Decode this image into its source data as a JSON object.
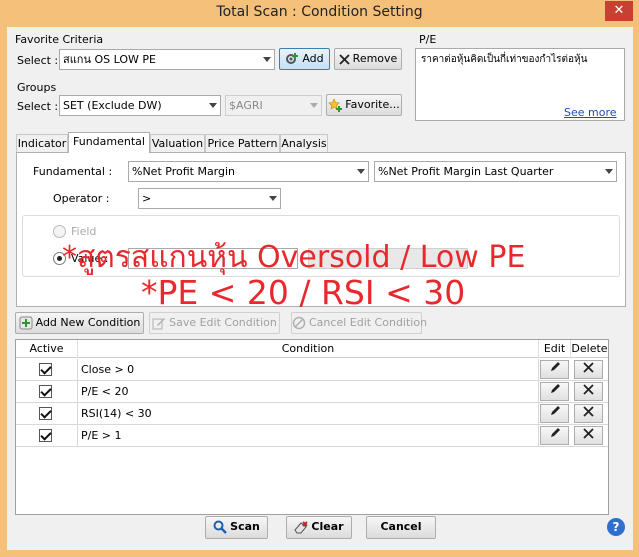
{
  "window": {
    "title": "Total Scan : Condition Setting",
    "close": "✕"
  },
  "favorite": {
    "group_label": "Favorite Criteria",
    "select_label": "Select :",
    "selected": "สแกน OS LOW PE",
    "add_label": "Add",
    "remove_label": "Remove"
  },
  "groups": {
    "group_label": "Groups",
    "select_label": "Select :",
    "selected": "SET (Exclude DW)",
    "sector": "$AGRI",
    "favorite_label": "Favorite..."
  },
  "pe_panel": {
    "title": "P/E",
    "description": "ราคาต่อหุ้นคิดเป็นกี่เท่าของกำไรต่อหุ้น",
    "see_more": "See more"
  },
  "tabs": [
    "Indicator",
    "Fundamental",
    "Valuation",
    "Price Pattern",
    "Analysis"
  ],
  "fundamental": {
    "label": "Fundamental :",
    "field1": "%Net Profit Margin",
    "field2": "%Net Profit Margin Last Quarter",
    "operator_label": "Operator :",
    "operator": ">",
    "field_radio_label": "Field",
    "value_radio_label": "Value :"
  },
  "annotations": {
    "line1": "*สูตรสแกนหุ้น Oversold / Low PE",
    "line2": "*PE < 20 / RSI < 30"
  },
  "condition_buttons": {
    "add": "Add New Condition",
    "save": "Save Edit Condition",
    "cancel": "Cancel Edit Condition"
  },
  "grid": {
    "headers": {
      "active": "Active",
      "condition": "Condition",
      "edit": "Edit",
      "delete": "Delete"
    },
    "rows": [
      {
        "condition": "Close > 0",
        "active": true
      },
      {
        "condition": "P/E < 20",
        "active": true
      },
      {
        "condition": "RSI(14) < 30",
        "active": true
      },
      {
        "condition": "P/E > 1",
        "active": true
      }
    ]
  },
  "footer": {
    "scan": "Scan",
    "clear": "Clear",
    "cancel": "Cancel",
    "help": "?"
  },
  "colors": {
    "frame": "#f4c07a",
    "annotation": "#e8282c",
    "link": "#1a4fb5"
  },
  "icons": [
    "close-icon",
    "gear-plus-icon",
    "x-icon",
    "star-icon",
    "plus-icon",
    "edit-icon",
    "cancel-circle-icon",
    "pencil-icon",
    "delete-icon",
    "magnifier-icon",
    "eraser-icon",
    "help-icon"
  ]
}
